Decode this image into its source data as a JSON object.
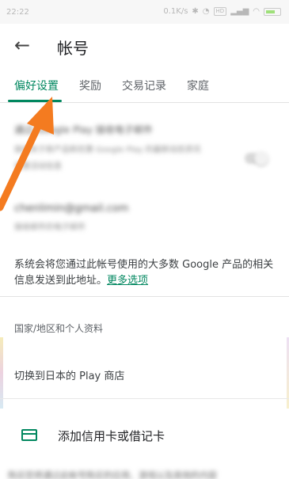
{
  "status_bar": {
    "time": "22:22",
    "network_speed": "0.1K/s",
    "network_badge": "HD",
    "battery_color": "#9fe07a"
  },
  "app_bar": {
    "back_icon": "arrow-left-icon",
    "title": "帐号"
  },
  "tabs": [
    {
      "label": "偏好设置",
      "active": true
    },
    {
      "label": "奖励",
      "active": false
    },
    {
      "label": "交易记录",
      "active": false
    },
    {
      "label": "家庭",
      "active": false
    }
  ],
  "account_setting": {
    "title": "通过 Google Play 接收电子邮件",
    "line2": "接收关于新产品和优惠 Google Play 的最新动态资讯",
    "line3": "优惠活动信息"
  },
  "email": {
    "address": "chenlimin@gmail.com",
    "caption": "接收邮件的电子邮件"
  },
  "notice": {
    "text": "系统会将您通过此帐号使用的大多数 Google 产品的相关信息发送到此地址。",
    "link": "更多选项"
  },
  "section_label": "国家/地区和个人资料",
  "switch_store": "切换到日本的 Play 商店",
  "add_card": {
    "icon": "credit-card-icon",
    "label": "添加信用卡或借记卡"
  },
  "bottom_blurred_text": "购买您将通过此帐号购买的应用、游戏以及其他的内容",
  "colors": {
    "accent": "#01875f",
    "annotation_arrow": "#f47b20"
  }
}
